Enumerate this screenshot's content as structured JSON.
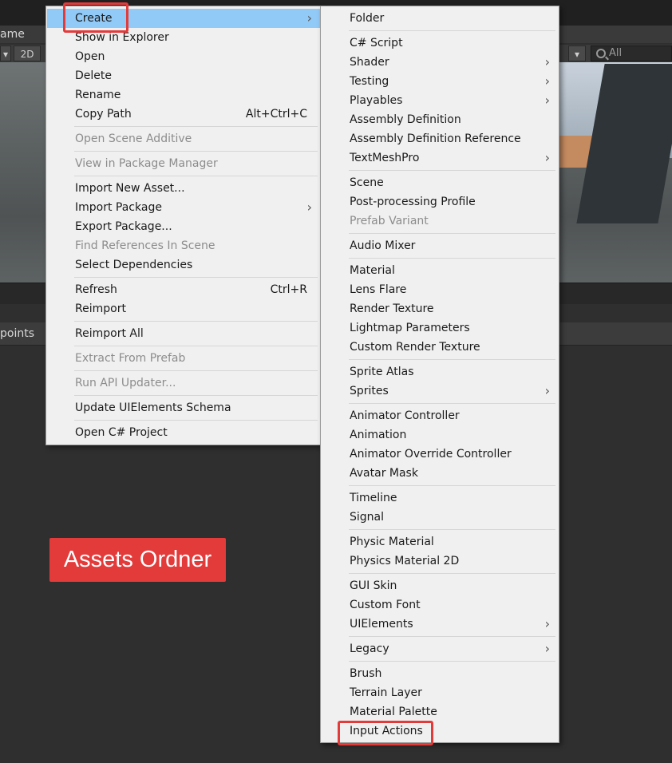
{
  "editor": {
    "scene_tab": "ame",
    "toolbar_2d": "2D",
    "search_placeholder": "All",
    "panel_label": "points"
  },
  "left_menu": {
    "items": [
      {
        "label": "Create",
        "submenu": true,
        "highlighted": true
      },
      {
        "label": "Show in Explorer"
      },
      {
        "label": "Open"
      },
      {
        "label": "Delete"
      },
      {
        "label": "Rename"
      },
      {
        "label": "Copy Path",
        "shortcut": "Alt+Ctrl+C"
      },
      {
        "label": "Open Scene Additive",
        "disabled": true
      },
      {
        "label": "View in Package Manager",
        "disabled": true
      },
      {
        "label": "Import New Asset..."
      },
      {
        "label": "Import Package",
        "submenu": true
      },
      {
        "label": "Export Package..."
      },
      {
        "label": "Find References In Scene",
        "disabled": true
      },
      {
        "label": "Select Dependencies"
      },
      {
        "label": "Refresh",
        "shortcut": "Ctrl+R"
      },
      {
        "label": "Reimport"
      },
      {
        "label": "Reimport All"
      },
      {
        "label": "Extract From Prefab",
        "disabled": true
      },
      {
        "label": "Run API Updater...",
        "disabled": true
      },
      {
        "label": "Update UIElements Schema"
      },
      {
        "label": "Open C# Project"
      }
    ]
  },
  "right_menu": {
    "items": [
      {
        "label": "Folder"
      },
      {
        "label": "C# Script"
      },
      {
        "label": "Shader",
        "submenu": true
      },
      {
        "label": "Testing",
        "submenu": true
      },
      {
        "label": "Playables",
        "submenu": true
      },
      {
        "label": "Assembly Definition"
      },
      {
        "label": "Assembly Definition Reference"
      },
      {
        "label": "TextMeshPro",
        "submenu": true
      },
      {
        "label": "Scene"
      },
      {
        "label": "Post-processing Profile"
      },
      {
        "label": "Prefab Variant",
        "disabled": true
      },
      {
        "label": "Audio Mixer"
      },
      {
        "label": "Material"
      },
      {
        "label": "Lens Flare"
      },
      {
        "label": "Render Texture"
      },
      {
        "label": "Lightmap Parameters"
      },
      {
        "label": "Custom Render Texture"
      },
      {
        "label": "Sprite Atlas"
      },
      {
        "label": "Sprites",
        "submenu": true
      },
      {
        "label": "Animator Controller"
      },
      {
        "label": "Animation"
      },
      {
        "label": "Animator Override Controller"
      },
      {
        "label": "Avatar Mask"
      },
      {
        "label": "Timeline"
      },
      {
        "label": "Signal"
      },
      {
        "label": "Physic Material"
      },
      {
        "label": "Physics Material 2D"
      },
      {
        "label": "GUI Skin"
      },
      {
        "label": "Custom Font"
      },
      {
        "label": "UIElements",
        "submenu": true
      },
      {
        "label": "Legacy",
        "submenu": true
      },
      {
        "label": "Brush"
      },
      {
        "label": "Terrain Layer"
      },
      {
        "label": "Material Palette"
      },
      {
        "label": "Input Actions"
      }
    ]
  },
  "annotation": {
    "label": "Assets Ordner",
    "color": "#e33a3a"
  }
}
